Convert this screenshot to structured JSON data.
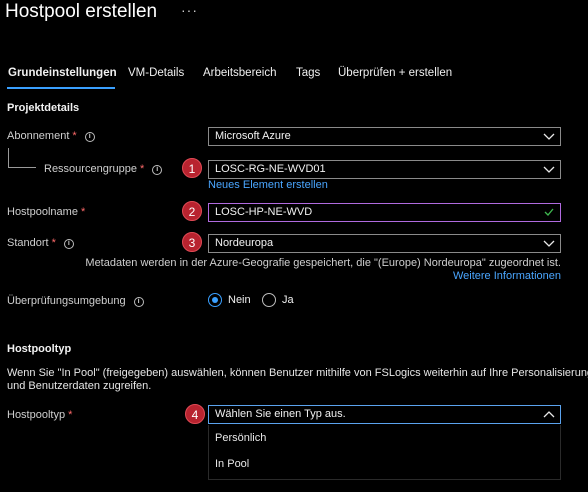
{
  "header": {
    "title": "Hostpool erstellen",
    "more": "···"
  },
  "tabs": [
    {
      "label": "Grundeinstellungen"
    },
    {
      "label": "VM-Details"
    },
    {
      "label": "Arbeitsbereich"
    },
    {
      "label": "Tags"
    },
    {
      "label": "Überprüfen + erstellen"
    }
  ],
  "projekt": {
    "heading": "Projektdetails",
    "abonnement": {
      "label": "Abonnement",
      "value": "Microsoft Azure"
    },
    "ressourcengruppe": {
      "label": "Ressourcengruppe",
      "value": "LOSC-RG-NE-WVD01",
      "badge": "1",
      "link": "Neues Element erstellen"
    }
  },
  "hostpoolname": {
    "label": "Hostpoolname",
    "value": "LOSC-HP-NE-WVD",
    "badge": "2"
  },
  "standort": {
    "label": "Standort",
    "value": "Nordeuropa",
    "badge": "3",
    "note": "Metadaten werden in der Azure-Geografie gespeichert, die \"(Europe) Nordeuropa\" zugeordnet ist.",
    "link": "Weitere Informationen"
  },
  "validation": {
    "label": "Überprüfungsumgebung",
    "options": [
      "Nein",
      "Ja"
    ],
    "selected": "Nein"
  },
  "hostpooltyp": {
    "heading": "Hostpooltyp",
    "desc_line1": "Wenn Sie \"In Pool\" (freigegeben) auswählen, können Benutzer mithilfe von FSLogics weiterhin auf Ihre Personalisierungs-",
    "desc_line2": "und Benutzerdaten zugreifen.",
    "label": "Hostpooltyp",
    "placeholder": "Wählen Sie einen Typ aus.",
    "badge": "4",
    "options": [
      "Persönlich",
      "In Pool"
    ]
  },
  "colors": {
    "accent": "#3aa0ff",
    "required": "#ff6a6a",
    "badge": "#b8232f",
    "link": "#4aa6ff",
    "valid": "#3fb950"
  }
}
